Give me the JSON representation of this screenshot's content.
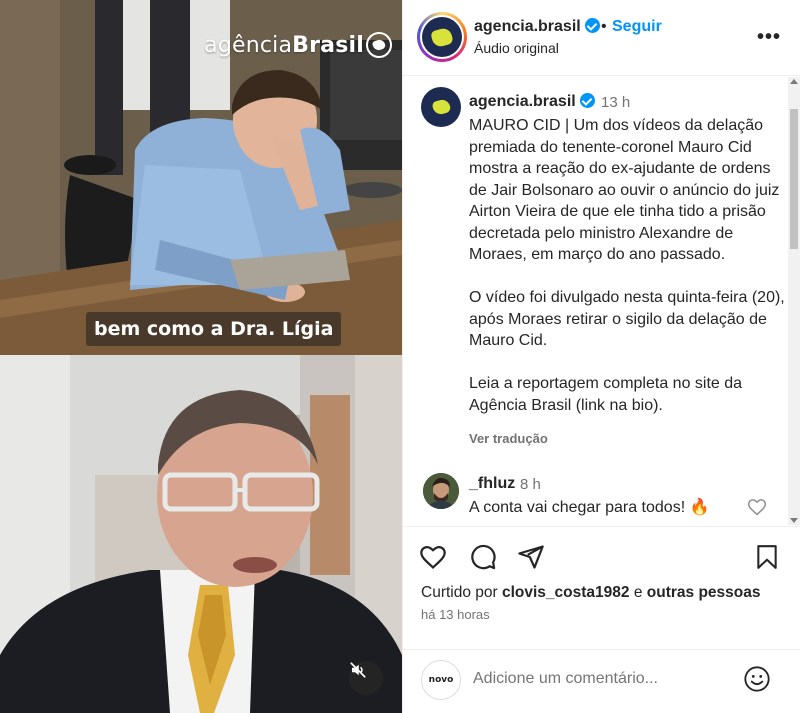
{
  "media": {
    "watermark_light": "agência",
    "watermark_bold": "Brasil",
    "subtitle": "bem como a Dra. Lígia",
    "mute_icon": "muted-speaker-icon"
  },
  "header": {
    "username": "agencia.brasil",
    "separator": "•",
    "follow_label": "Seguir",
    "audio_label": "Áudio original",
    "more_label": "•••"
  },
  "post": {
    "username": "agencia.brasil",
    "time": "13 h",
    "caption_paragraphs": [
      "MAURO CID | Um dos vídeos da delação premiada do tenente-coronel Mauro Cid mostra a reação do ex-ajudante de ordens de Jair Bolsonaro ao ouvir o anúncio do juiz Airton Vieira de que ele tinha tido a prisão decretada pelo ministro Alexandre de Moraes, em março do ano passado.",
      "O vídeo foi divulgado nesta quinta-feira (20), após Moraes retirar o sigilo da delação de Mauro Cid.",
      "Leia a reportagem completa no site da Agência Brasil (link na bio)."
    ],
    "translate_label": "Ver tradução"
  },
  "comment": {
    "username": "_fhluz",
    "time": "8 h",
    "text": "A conta vai chegar para todos! 🔥"
  },
  "actions": {
    "liked_prefix": "Curtido por ",
    "liked_user": "clovis_costa1982",
    "liked_mid": " e ",
    "liked_others": "outras pessoas",
    "posted_ago": "há 13 horas"
  },
  "comment_box": {
    "avatar_text": "novo",
    "placeholder": "Adicione um comentário..."
  },
  "colors": {
    "accent": "#0095f6",
    "text": "#262626",
    "muted": "#737373",
    "brand_navy": "#1d2b53",
    "brand_yellow": "#d8e23a"
  }
}
